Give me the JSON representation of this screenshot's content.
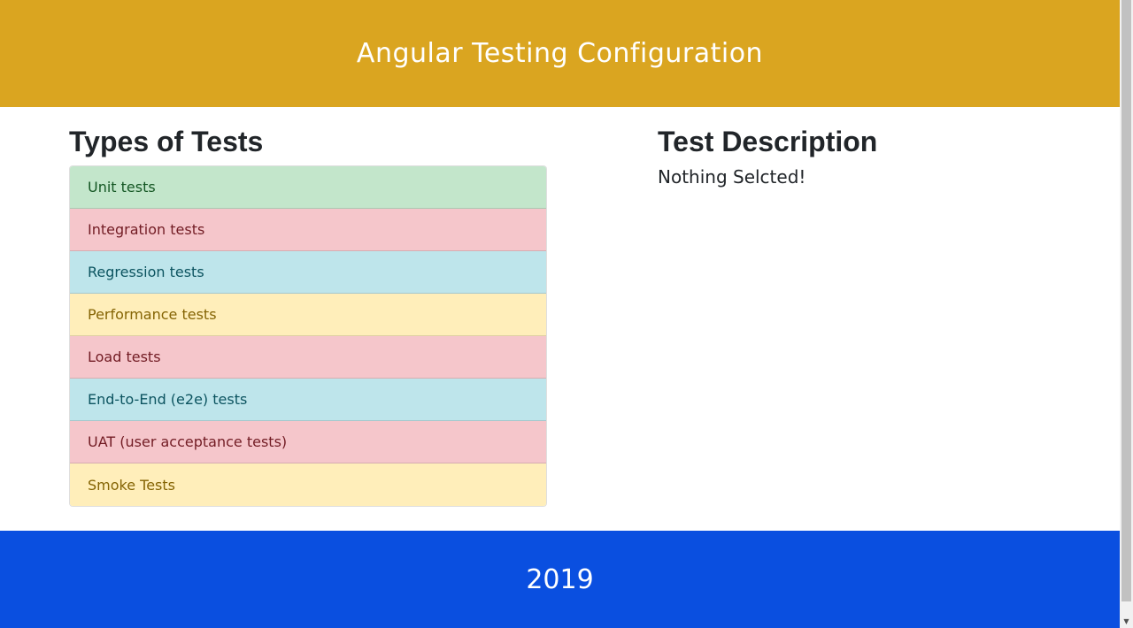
{
  "header": {
    "title": "Angular Testing Configuration"
  },
  "tests": {
    "heading": "Types of Tests",
    "items": [
      {
        "label": "Unit tests",
        "variant": "success"
      },
      {
        "label": "Integration tests",
        "variant": "danger"
      },
      {
        "label": "Regression tests",
        "variant": "info"
      },
      {
        "label": "Performance tests",
        "variant": "warning"
      },
      {
        "label": "Load tests",
        "variant": "danger"
      },
      {
        "label": "End-to-End (e2e) tests",
        "variant": "info"
      },
      {
        "label": "UAT (user acceptance tests)",
        "variant": "danger"
      },
      {
        "label": "Smoke Tests",
        "variant": "warning"
      }
    ]
  },
  "description": {
    "heading": "Test Description",
    "text": "Nothing Selcted!"
  },
  "footer": {
    "year": "2019"
  },
  "colors": {
    "header_bg": "#daa520",
    "footer_bg": "#0a4fe0",
    "success": "#c3e6cb",
    "danger": "#f5c6cb",
    "info": "#bee5eb",
    "warning": "#ffeeba"
  },
  "scrollbar": {
    "up_icon": "arrow-up-icon",
    "down_icon": "arrow-down-icon"
  }
}
